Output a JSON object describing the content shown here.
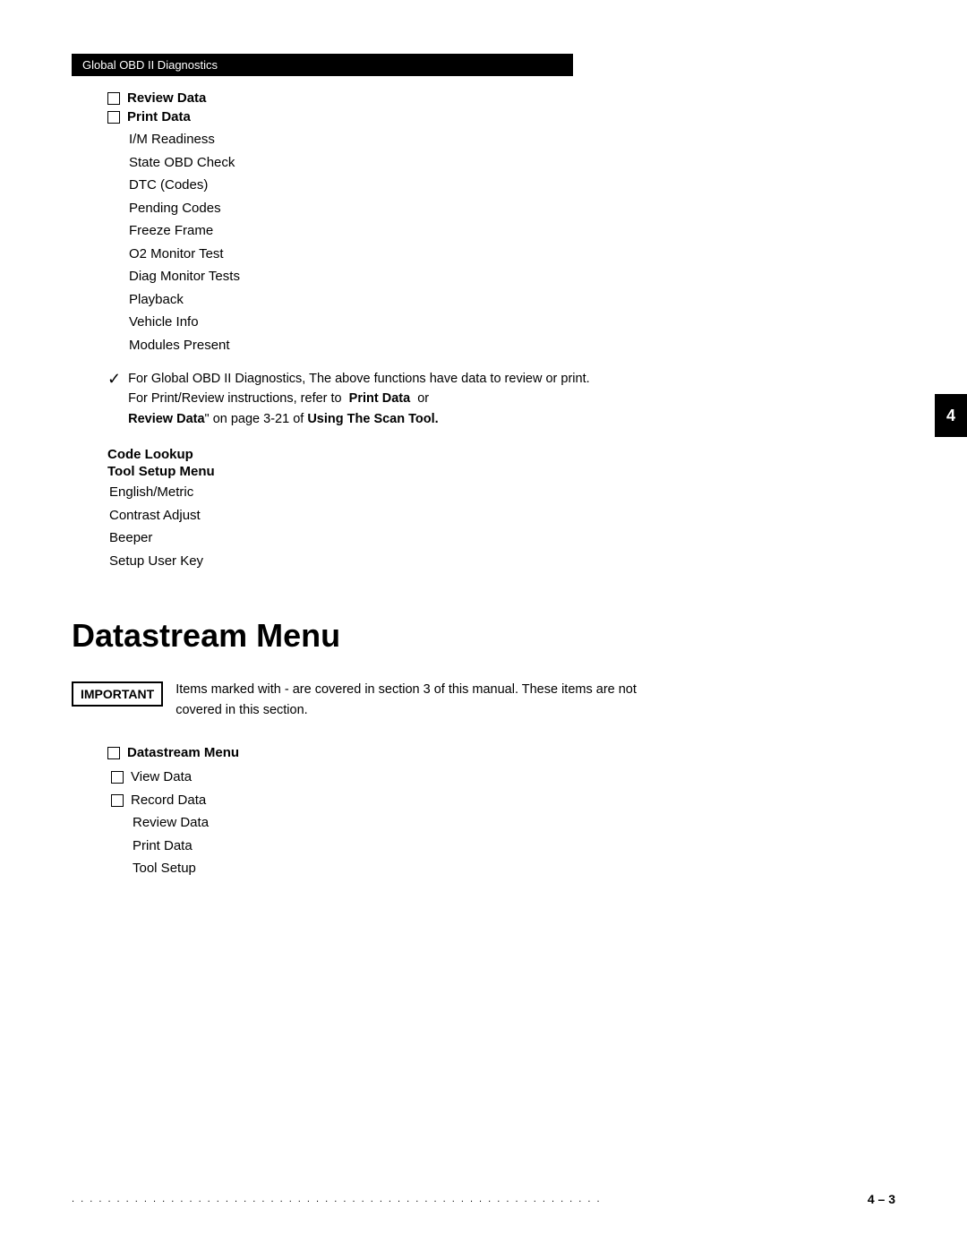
{
  "header": {
    "bar_label": "Global OBD II Diagnostics"
  },
  "menu": {
    "review_data": "Review Data",
    "print_data": "Print Data",
    "sub_items": [
      "I/M Readiness",
      "State OBD Check",
      "DTC (Codes)",
      "Pending Codes",
      "Freeze Frame",
      "O2 Monitor Test",
      "Diag Monitor Tests",
      "Playback",
      "Vehicle Info",
      "Modules Present"
    ]
  },
  "note": {
    "text": "For Global OBD II Diagnostics, The above functions have data to review or print. For Print/Review instructions, refer to ",
    "bold1": "Print Data",
    "middle": " or ",
    "bold2_prefix": "Review Data",
    "suffix": "\" on page 3-21 of ",
    "bold3": "Using The Scan Tool."
  },
  "tool_setup": {
    "code_lookup": "Code Lookup",
    "tool_setup_menu": "Tool Setup Menu",
    "items": [
      "English/Metric",
      "Contrast Adjust",
      "Beeper",
      "Setup User Key"
    ]
  },
  "tab_marker": "4",
  "datastream_title": "Datastream Menu",
  "important_box": "IMPORTANT",
  "important_text": "Items marked with  -  are covered in section 3 of this manual. These items are not covered in this section.",
  "datastream_menu": {
    "title": "Datastream Menu",
    "checkbox_items": [
      "View Data",
      "Record Data"
    ],
    "plain_items": [
      "Review Data",
      "Print Data",
      "Tool Setup"
    ]
  },
  "footer": {
    "dots": "........................................................",
    "page": "4 – 3"
  }
}
